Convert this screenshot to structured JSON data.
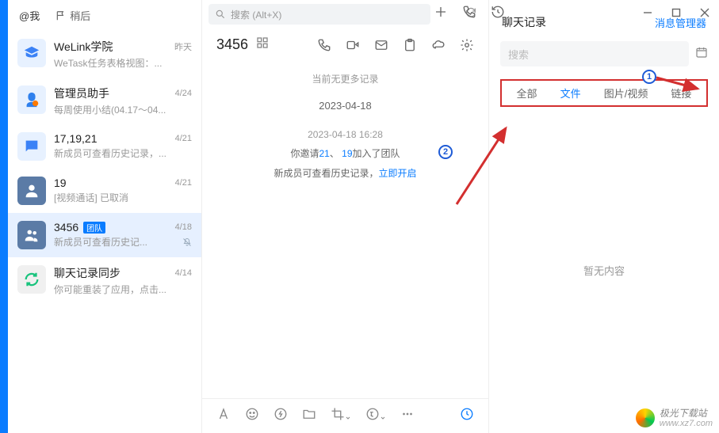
{
  "header": {
    "tab_me": "@我",
    "tab_later": "稍后",
    "search_placeholder": "搜索 (Alt+X)"
  },
  "chats": [
    {
      "title": "WeLink学院",
      "time": "昨天",
      "preview": "WeTask任务表格视图：..."
    },
    {
      "title": "管理员助手",
      "time": "4/24",
      "preview": "每周使用小结(04.17～04..."
    },
    {
      "title": "17,19,21",
      "time": "4/21",
      "preview": "新成员可查看历史记录，..."
    },
    {
      "title": "19",
      "time": "4/21",
      "preview": "[视频通话] 已取消"
    },
    {
      "title": "3456",
      "badge": "团队",
      "time": "4/18",
      "preview": "新成员可查看历史记..."
    },
    {
      "title": "聊天记录同步",
      "time": "4/14",
      "preview": "你可能重装了应用，点击..."
    }
  ],
  "main": {
    "title": "3456",
    "no_more": "当前无更多记录",
    "date": "2023-04-18",
    "timestamp": "2023-04-18 16:28",
    "invite_prefix": "你邀请",
    "invite_u1": "21",
    "invite_sep": "、",
    "invite_u2": "19",
    "invite_suffix": "加入了团队",
    "history_text": "新成员可查看历史记录，",
    "history_link": "立即开启"
  },
  "right": {
    "title": "聊天记录",
    "manager": "消息管理器",
    "search_placeholder": "搜索",
    "tabs": {
      "all": "全部",
      "file": "文件",
      "media": "图片/视频",
      "link": "链接"
    },
    "empty": "暂无内容"
  },
  "watermark": {
    "brand": "极光下载站",
    "url": "www.xz7.com"
  },
  "annot": {
    "b1": "1",
    "b2": "2"
  }
}
